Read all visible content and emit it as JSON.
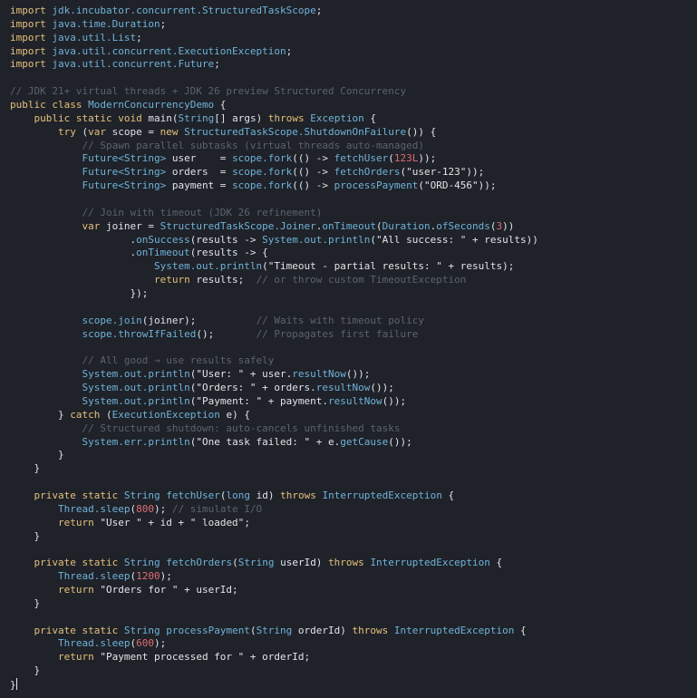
{
  "editor": {
    "language": "java",
    "colors": {
      "background": "#1f2229",
      "keyword": "#e5c07b",
      "type": "#6fb3d9",
      "string": "#e2e4e8",
      "number": "#e06c75",
      "comment": "#5c6370",
      "plain": "#dfe3ea"
    },
    "lines": [
      [
        [
          "kw",
          "import"
        ],
        [
          "p",
          " "
        ],
        [
          "pkg",
          "jdk.incubator.concurrent.StructuredTaskScope"
        ],
        [
          "p",
          ";"
        ]
      ],
      [
        [
          "kw",
          "import"
        ],
        [
          "p",
          " "
        ],
        [
          "pkg",
          "java.time.Duration"
        ],
        [
          "p",
          ";"
        ]
      ],
      [
        [
          "kw",
          "import"
        ],
        [
          "p",
          " "
        ],
        [
          "pkg",
          "java.util.List"
        ],
        [
          "p",
          ";"
        ]
      ],
      [
        [
          "kw",
          "import"
        ],
        [
          "p",
          " "
        ],
        [
          "pkg",
          "java.util.concurrent.ExecutionException"
        ],
        [
          "p",
          ";"
        ]
      ],
      [
        [
          "kw",
          "import"
        ],
        [
          "p",
          " "
        ],
        [
          "pkg",
          "java.util.concurrent.Future"
        ],
        [
          "p",
          ";"
        ]
      ],
      [],
      [
        [
          "com",
          "// JDK 21+ virtual threads + JDK 26 preview Structured Concurrency"
        ]
      ],
      [
        [
          "kw",
          "public class"
        ],
        [
          "p",
          " "
        ],
        [
          "type",
          "ModernConcurrencyDemo"
        ],
        [
          "p",
          " {"
        ]
      ],
      [
        [
          "p",
          "    "
        ],
        [
          "kw",
          "public static void"
        ],
        [
          "p",
          " main("
        ],
        [
          "type",
          "String"
        ],
        [
          "p",
          "[] args) "
        ],
        [
          "kw",
          "throws"
        ],
        [
          "p",
          " "
        ],
        [
          "type",
          "Exception"
        ],
        [
          "p",
          " {"
        ]
      ],
      [
        [
          "p",
          "        "
        ],
        [
          "kw",
          "try"
        ],
        [
          "p",
          " ("
        ],
        [
          "kw",
          "var"
        ],
        [
          "p",
          " scope = "
        ],
        [
          "kw",
          "new"
        ],
        [
          "p",
          " "
        ],
        [
          "type",
          "StructuredTaskScope.ShutdownOnFailure"
        ],
        [
          "p",
          "()) {"
        ]
      ],
      [
        [
          "p",
          "            "
        ],
        [
          "com",
          "// Spawn parallel subtasks (virtual threads auto-managed)"
        ]
      ],
      [
        [
          "p",
          "            "
        ],
        [
          "type",
          "Future<String>"
        ],
        [
          "p",
          " user    = "
        ],
        [
          "fn",
          "scope.fork"
        ],
        [
          "p",
          "(() -> "
        ],
        [
          "fn",
          "fetchUser"
        ],
        [
          "p",
          "("
        ],
        [
          "num",
          "123L"
        ],
        [
          "p",
          "));"
        ]
      ],
      [
        [
          "p",
          "            "
        ],
        [
          "type",
          "Future<String>"
        ],
        [
          "p",
          " orders  = "
        ],
        [
          "fn",
          "scope.fork"
        ],
        [
          "p",
          "(() -> "
        ],
        [
          "fn",
          "fetchOrders"
        ],
        [
          "p",
          "("
        ],
        [
          "str",
          "\"user-123\""
        ],
        [
          "p",
          "));"
        ]
      ],
      [
        [
          "p",
          "            "
        ],
        [
          "type",
          "Future<String>"
        ],
        [
          "p",
          " payment = "
        ],
        [
          "fn",
          "scope.fork"
        ],
        [
          "p",
          "(() -> "
        ],
        [
          "fn",
          "processPayment"
        ],
        [
          "p",
          "("
        ],
        [
          "str",
          "\"ORD-456\""
        ],
        [
          "p",
          "));"
        ]
      ],
      [],
      [
        [
          "p",
          "            "
        ],
        [
          "com",
          "// Join with timeout (JDK 26 refinement)"
        ]
      ],
      [
        [
          "p",
          "            "
        ],
        [
          "kw",
          "var"
        ],
        [
          "p",
          " joiner = "
        ],
        [
          "type",
          "StructuredTaskScope.Joiner"
        ],
        [
          "p",
          "."
        ],
        [
          "fn",
          "onTimeout"
        ],
        [
          "p",
          "("
        ],
        [
          "type",
          "Duration"
        ],
        [
          "p",
          "."
        ],
        [
          "fn",
          "ofSeconds"
        ],
        [
          "p",
          "("
        ],
        [
          "num",
          "3"
        ],
        [
          "p",
          "))"
        ]
      ],
      [
        [
          "p",
          "                    ."
        ],
        [
          "fn",
          "onSuccess"
        ],
        [
          "p",
          "(results -> "
        ],
        [
          "fn",
          "System.out.println"
        ],
        [
          "p",
          "("
        ],
        [
          "str",
          "\"All success: \""
        ],
        [
          "p",
          " + results))"
        ]
      ],
      [
        [
          "p",
          "                    ."
        ],
        [
          "fn",
          "onTimeout"
        ],
        [
          "p",
          "(results -> {"
        ]
      ],
      [
        [
          "p",
          "                        "
        ],
        [
          "fn",
          "System.out.println"
        ],
        [
          "p",
          "("
        ],
        [
          "str",
          "\"Timeout - partial results: \""
        ],
        [
          "p",
          " + results);"
        ]
      ],
      [
        [
          "p",
          "                        "
        ],
        [
          "kw",
          "return"
        ],
        [
          "p",
          " results;  "
        ],
        [
          "com",
          "// or throw custom TimeoutException"
        ]
      ],
      [
        [
          "p",
          "                    });"
        ]
      ],
      [],
      [
        [
          "p",
          "            "
        ],
        [
          "fn",
          "scope.join"
        ],
        [
          "p",
          "(joiner);          "
        ],
        [
          "com",
          "// Waits with timeout policy"
        ]
      ],
      [
        [
          "p",
          "            "
        ],
        [
          "fn",
          "scope.throwIfFailed"
        ],
        [
          "p",
          "();       "
        ],
        [
          "com",
          "// Propagates first failure"
        ]
      ],
      [],
      [
        [
          "p",
          "            "
        ],
        [
          "com",
          "// All good → use results safely"
        ]
      ],
      [
        [
          "p",
          "            "
        ],
        [
          "fn",
          "System.out.println"
        ],
        [
          "p",
          "("
        ],
        [
          "str",
          "\"User: \""
        ],
        [
          "p",
          " + user."
        ],
        [
          "fn",
          "resultNow"
        ],
        [
          "p",
          "());"
        ]
      ],
      [
        [
          "p",
          "            "
        ],
        [
          "fn",
          "System.out.println"
        ],
        [
          "p",
          "("
        ],
        [
          "str",
          "\"Orders: \""
        ],
        [
          "p",
          " + orders."
        ],
        [
          "fn",
          "resultNow"
        ],
        [
          "p",
          "());"
        ]
      ],
      [
        [
          "p",
          "            "
        ],
        [
          "fn",
          "System.out.println"
        ],
        [
          "p",
          "("
        ],
        [
          "str",
          "\"Payment: \""
        ],
        [
          "p",
          " + payment."
        ],
        [
          "fn",
          "resultNow"
        ],
        [
          "p",
          "());"
        ]
      ],
      [
        [
          "p",
          "        } "
        ],
        [
          "kw",
          "catch"
        ],
        [
          "p",
          " ("
        ],
        [
          "type",
          "ExecutionException"
        ],
        [
          "p",
          " e) {"
        ]
      ],
      [
        [
          "p",
          "            "
        ],
        [
          "com",
          "// Structured shutdown: auto-cancels unfinished tasks"
        ]
      ],
      [
        [
          "p",
          "            "
        ],
        [
          "fn",
          "System.err.println"
        ],
        [
          "p",
          "("
        ],
        [
          "str",
          "\"One task failed: \""
        ],
        [
          "p",
          " + e."
        ],
        [
          "fn",
          "getCause"
        ],
        [
          "p",
          "());"
        ]
      ],
      [
        [
          "p",
          "        }"
        ]
      ],
      [
        [
          "p",
          "    }"
        ]
      ],
      [],
      [
        [
          "p",
          "    "
        ],
        [
          "kw",
          "private static"
        ],
        [
          "p",
          " "
        ],
        [
          "type",
          "String"
        ],
        [
          "p",
          " "
        ],
        [
          "fn",
          "fetchUser"
        ],
        [
          "p",
          "("
        ],
        [
          "type",
          "long"
        ],
        [
          "p",
          " id) "
        ],
        [
          "kw",
          "throws"
        ],
        [
          "p",
          " "
        ],
        [
          "type",
          "InterruptedException"
        ],
        [
          "p",
          " {"
        ]
      ],
      [
        [
          "p",
          "        "
        ],
        [
          "fn",
          "Thread.sleep"
        ],
        [
          "p",
          "("
        ],
        [
          "num",
          "800"
        ],
        [
          "p",
          "); "
        ],
        [
          "com",
          "// simulate I/O"
        ]
      ],
      [
        [
          "p",
          "        "
        ],
        [
          "kw",
          "return"
        ],
        [
          "p",
          " "
        ],
        [
          "str",
          "\"User \""
        ],
        [
          "p",
          " + id + "
        ],
        [
          "str",
          "\" loaded\""
        ],
        [
          "p",
          ";"
        ]
      ],
      [
        [
          "p",
          "    }"
        ]
      ],
      [],
      [
        [
          "p",
          "    "
        ],
        [
          "kw",
          "private static"
        ],
        [
          "p",
          " "
        ],
        [
          "type",
          "String"
        ],
        [
          "p",
          " "
        ],
        [
          "fn",
          "fetchOrders"
        ],
        [
          "p",
          "("
        ],
        [
          "type",
          "String"
        ],
        [
          "p",
          " userId) "
        ],
        [
          "kw",
          "throws"
        ],
        [
          "p",
          " "
        ],
        [
          "type",
          "InterruptedException"
        ],
        [
          "p",
          " {"
        ]
      ],
      [
        [
          "p",
          "        "
        ],
        [
          "fn",
          "Thread.sleep"
        ],
        [
          "p",
          "("
        ],
        [
          "num",
          "1200"
        ],
        [
          "p",
          ");"
        ]
      ],
      [
        [
          "p",
          "        "
        ],
        [
          "kw",
          "return"
        ],
        [
          "p",
          " "
        ],
        [
          "str",
          "\"Orders for \""
        ],
        [
          "p",
          " + userId;"
        ]
      ],
      [
        [
          "p",
          "    }"
        ]
      ],
      [],
      [
        [
          "p",
          "    "
        ],
        [
          "kw",
          "private static"
        ],
        [
          "p",
          " "
        ],
        [
          "type",
          "String"
        ],
        [
          "p",
          " "
        ],
        [
          "fn",
          "processPayment"
        ],
        [
          "p",
          "("
        ],
        [
          "type",
          "String"
        ],
        [
          "p",
          " orderId) "
        ],
        [
          "kw",
          "throws"
        ],
        [
          "p",
          " "
        ],
        [
          "type",
          "InterruptedException"
        ],
        [
          "p",
          " {"
        ]
      ],
      [
        [
          "p",
          "        "
        ],
        [
          "fn",
          "Thread.sleep"
        ],
        [
          "p",
          "("
        ],
        [
          "num",
          "600"
        ],
        [
          "p",
          ");"
        ]
      ],
      [
        [
          "p",
          "        "
        ],
        [
          "kw",
          "return"
        ],
        [
          "p",
          " "
        ],
        [
          "str",
          "\"Payment processed for \""
        ],
        [
          "p",
          " + orderId;"
        ]
      ],
      [
        [
          "p",
          "    }"
        ]
      ],
      [
        [
          "p",
          "}"
        ],
        [
          "caret",
          ""
        ]
      ]
    ]
  }
}
